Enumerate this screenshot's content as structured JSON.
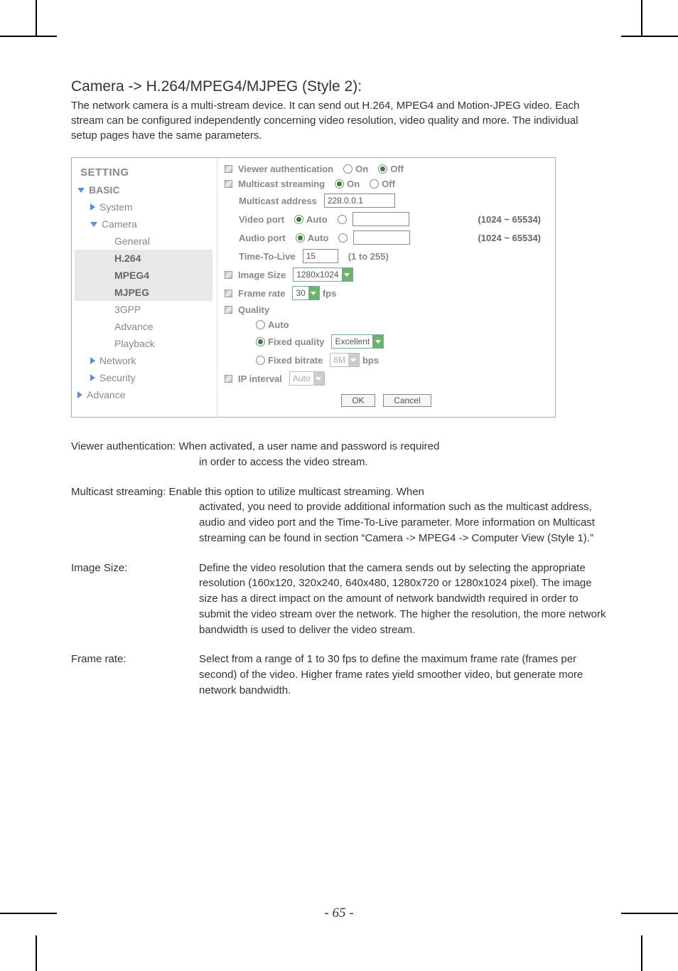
{
  "section_title": "Camera -> H.264/MPEG4/MJPEG (Style 2):",
  "intro": "The network camera is a multi-stream device. It can send out H.264, MPEG4 and Motion-JPEG video. Each stream can be configured independently concerning video resolution, video quality and more. The individual setup pages have the same parameters.",
  "sidebar": {
    "heading": "SETTING",
    "basic": "BASIC",
    "system": "System",
    "camera": "Camera",
    "general": "General",
    "h264": "H.264",
    "mpeg4": "MPEG4",
    "mjpeg": "MJPEG",
    "gpp": "3GPP",
    "advance": "Advance",
    "playback": "Playback",
    "network": "Network",
    "security": "Security",
    "advance2": "Advance"
  },
  "panel": {
    "viewer_auth": "Viewer authentication",
    "on": "On",
    "off": "Off",
    "multicast_streaming": "Multicast streaming",
    "multicast_address": "Multicast address",
    "multicast_address_val": "228.0.0.1",
    "video_port": "Video port",
    "audio_port": "Audio port",
    "auto": "Auto",
    "port_range": "(1024 ~ 65534)",
    "ttl": "Time-To-Live",
    "ttl_val": "15",
    "ttl_range": "(1 to 255)",
    "image_size": "Image Size",
    "image_size_val": "1280x1024",
    "frame_rate": "Frame rate",
    "frame_rate_val": "30",
    "fps": "fps",
    "quality": "Quality",
    "q_auto": "Auto",
    "q_fixed_quality": "Fixed quality",
    "q_fixed_quality_val": "Excellent",
    "q_fixed_bitrate": "Fixed bitrate",
    "q_fixed_bitrate_val": "6M",
    "bps": "bps",
    "ip_interval": "IP interval",
    "ip_interval_val": "Auto",
    "ok": "OK",
    "cancel": "Cancel"
  },
  "desc": {
    "viewer_auth_lbl": "Viewer authentication: ",
    "viewer_auth_txt_first": "When activated, a user name and password is required",
    "viewer_auth_txt_rest": "in order to access the video stream.",
    "multicast_lbl": "Multicast streaming: ",
    "multicast_txt_first": "Enable this option to utilize multicast streaming. When",
    "multicast_txt_rest": "activated, you need to provide additional information such as the multicast address, audio and video port and the Time-To-Live parameter. More information on Multicast streaming can be found in section “Camera -> MPEG4 -> Computer View (Style 1).”",
    "image_size_lbl": "Image Size:",
    "image_size_txt": "Define the video resolution that the camera sends out by selecting the appropriate resolution (160x120, 320x240, 640x480, 1280x720 or 1280x1024 pixel). The image size has a direct impact on the amount of network bandwidth required in order to submit the video stream over the network. The higher the resolution, the more network bandwidth is used to deliver the video stream.",
    "frame_rate_lbl": "Frame rate:",
    "frame_rate_txt": "Select from a range of 1 to 30 fps to define the maximum frame rate (frames per second) of the video. Higher frame rates yield smoother video, but generate more network bandwidth."
  },
  "page_number": "- 65 -"
}
